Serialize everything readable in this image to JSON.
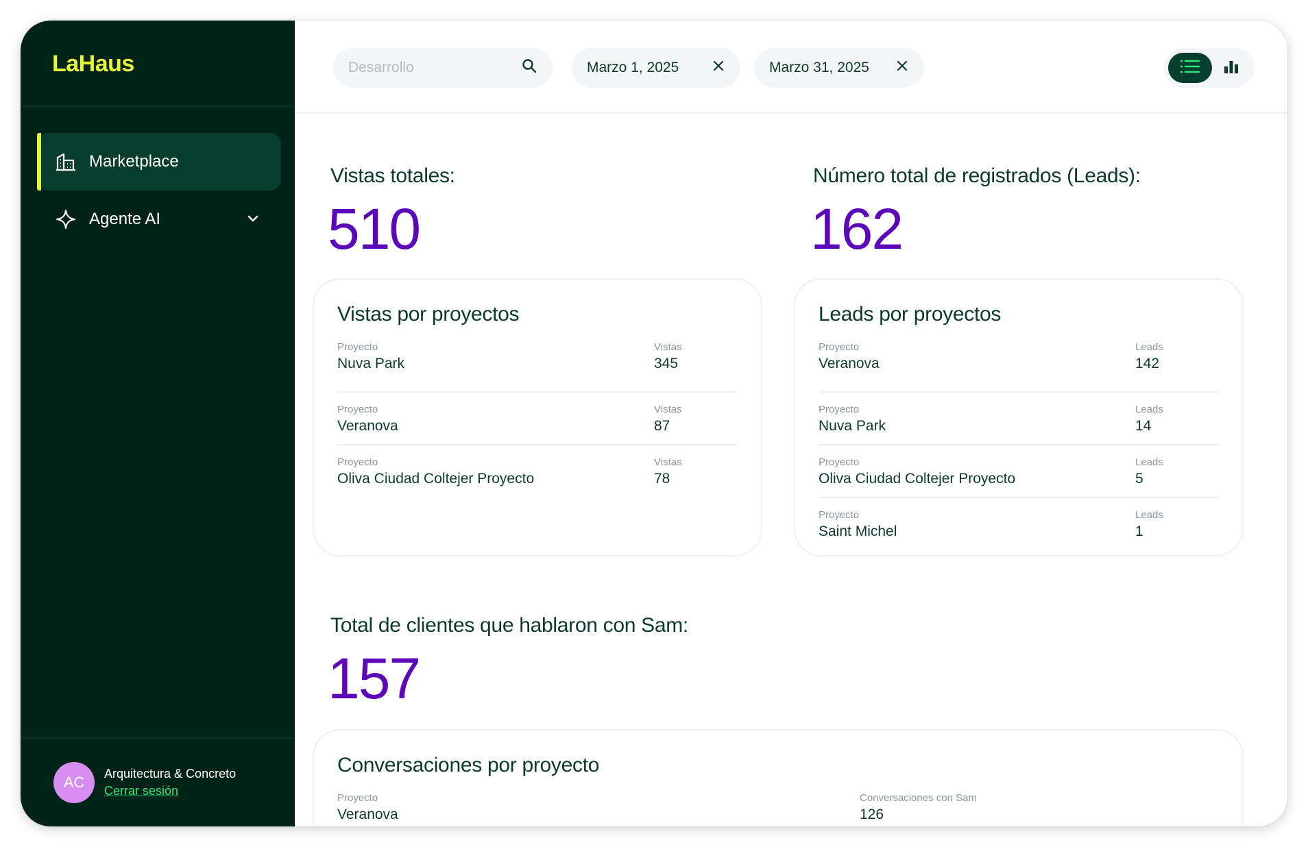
{
  "sidebar": {
    "logo": "LaHaus",
    "items": [
      {
        "label": "Marketplace",
        "active": true
      },
      {
        "label": "Agente AI",
        "active": false
      }
    ],
    "user": {
      "initials": "AC",
      "name": "Arquitectura & Concreto",
      "logout": "Cerrar sesión"
    }
  },
  "topbar": {
    "search_placeholder": "Desarrollo",
    "date_from": "Marzo 1, 2025",
    "date_to": "Marzo 31, 2025"
  },
  "stats": {
    "views_label": "Vistas totales:",
    "views_value": "510",
    "leads_label": "Número total de registrados (Leads):",
    "leads_value": "162",
    "clients_label": "Total de clientes que hablaron con Sam:",
    "clients_value": "157"
  },
  "views_card": {
    "title": "Vistas por proyectos",
    "rows": [
      {
        "project_label": "Proyecto",
        "project": "Nuva Park",
        "metric_label": "Vistas",
        "value": "345"
      },
      {
        "project_label": "Proyecto",
        "project": "Veranova",
        "metric_label": "Vistas",
        "value": "87"
      },
      {
        "project_label": "Proyecto",
        "project": "Oliva Ciudad Coltejer Proyecto",
        "metric_label": "Vistas",
        "value": "78"
      }
    ]
  },
  "leads_card": {
    "title": "Leads por proyectos",
    "rows": [
      {
        "project_label": "Proyecto",
        "project": "Veranova",
        "metric_label": "Leads",
        "value": "142"
      },
      {
        "project_label": "Proyecto",
        "project": "Nuva Park",
        "metric_label": "Leads",
        "value": "14"
      },
      {
        "project_label": "Proyecto",
        "project": "Oliva Ciudad Coltejer Proyecto",
        "metric_label": "Leads",
        "value": "5"
      },
      {
        "project_label": "Proyecto",
        "project": "Saint Michel",
        "metric_label": "Leads",
        "value": "1"
      }
    ]
  },
  "conversations_card": {
    "title": "Conversaciones por proyecto",
    "rows": [
      {
        "project_label": "Proyecto",
        "project": "Veranova",
        "metric_label": "Conversaciones con Sam",
        "value": "126"
      }
    ]
  },
  "colors": {
    "sidebar_bg": "#032218",
    "accent_yellow": "#e6f53a",
    "stat_purple": "#5b06b8",
    "link_green": "#2ee67a",
    "avatar_pink": "#d88ef0"
  }
}
